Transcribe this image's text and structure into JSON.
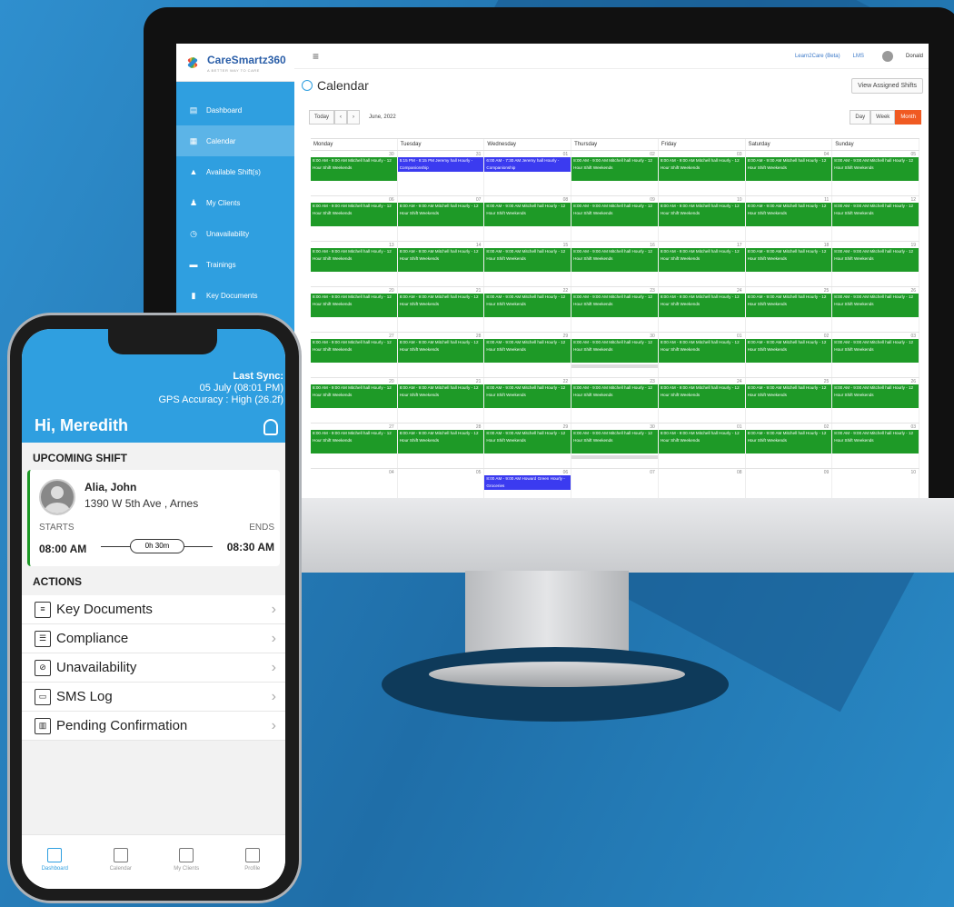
{
  "desktop": {
    "brand": {
      "name": "CareSmartz360",
      "tagline": "A BETTER WAY TO CARE"
    },
    "sidebar": {
      "items": [
        {
          "label": "Dashboard",
          "icon": "dashboard-icon"
        },
        {
          "label": "Calendar",
          "icon": "calendar-icon"
        },
        {
          "label": "Available Shift(s)",
          "icon": "person-icon"
        },
        {
          "label": "My Clients",
          "icon": "clients-icon"
        },
        {
          "label": "Unavailability",
          "icon": "clock-icon"
        },
        {
          "label": "Trainings",
          "icon": "training-icon"
        },
        {
          "label": "Key Documents",
          "icon": "document-icon"
        }
      ]
    },
    "topbar": {
      "link1": "Learn2Care (Beta)",
      "link2": "LMS",
      "user": "Donald"
    },
    "calendar": {
      "title": "Calendar",
      "view_assigned": "View Assigned Shifts",
      "today": "Today",
      "prev": "‹",
      "next": "›",
      "date_label": "June, 2022",
      "views": [
        "Day",
        "Week",
        "Month"
      ],
      "weekdays": [
        "Monday",
        "Tuesday",
        "Wednesday",
        "Thursday",
        "Friday",
        "Saturday",
        "Sunday"
      ],
      "green_event": "8:00 AM - 9:00 AM Mitchell hall Hourly - 12 Hour Shift Weekends",
      "blue_event_tue": "5:15 PM - 8:15 PM Jeremy hall Hourly - Companionship",
      "blue_event_wed": "6:00 AM - 7:30 AM Jeremy hall Hourly - Companionship",
      "blue_event_last": "8:00 AM - 9:00 AM Howard Green Hourly - Groceries",
      "weeks": [
        [
          "30",
          "31",
          "01",
          "02",
          "03",
          "04",
          "05"
        ],
        [
          "06",
          "07",
          "08",
          "09",
          "10",
          "11",
          "12"
        ],
        [
          "13",
          "14",
          "15",
          "16",
          "17",
          "18",
          "19"
        ],
        [
          "20",
          "21",
          "22",
          "23",
          "24",
          "25",
          "26"
        ],
        [
          "27",
          "28",
          "29",
          "30",
          "01",
          "02",
          "03"
        ],
        [
          "20",
          "21",
          "22",
          "23",
          "24",
          "25",
          "26"
        ],
        [
          "27",
          "28",
          "29",
          "30",
          "01",
          "02",
          "03"
        ],
        [
          "04",
          "05",
          "06",
          "07",
          "08",
          "09",
          "10"
        ]
      ]
    }
  },
  "mobile": {
    "sync_label": "Last Sync:",
    "sync_time": "05 July (08:01 PM)",
    "gps": "GPS Accuracy : High (26.2f)",
    "greeting": "Hi, Meredith",
    "upcoming_heading": "UPCOMING SHIFT",
    "client_name": "Alia, John",
    "client_address": "1390 W 5th Ave , Arnes",
    "starts_label": "STARTS",
    "ends_label": "ENDS",
    "start_time": "08:00 AM",
    "end_time": "08:30 AM",
    "duration": "0h 30m",
    "actions_heading": "ACTIONS",
    "actions": [
      "Key Documents",
      "Compliance",
      "Unavailability",
      "SMS Log",
      "Pending Confirmation"
    ],
    "tabs": [
      "Dashboard",
      "Calendar",
      "My Clients",
      "Profile"
    ]
  }
}
